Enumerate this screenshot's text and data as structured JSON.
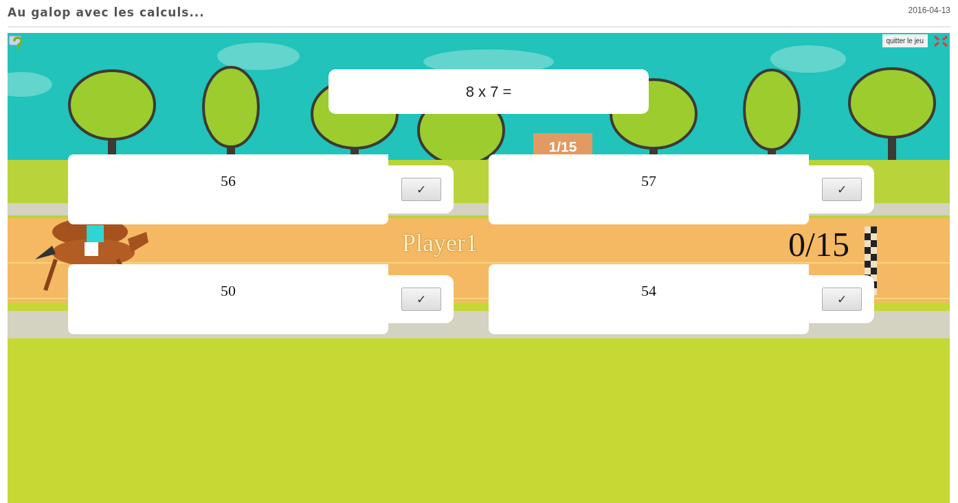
{
  "header": {
    "title": "Au galop avec les calculs...",
    "date": "2016-04-13"
  },
  "game": {
    "quit_button": "quitter le jeu",
    "question": "8 x 7 =",
    "progress": "1/15",
    "lanes": [
      {
        "player": "Player1",
        "score": "0/15"
      }
    ],
    "answers": [
      {
        "value": "56",
        "button": "✓"
      },
      {
        "value": "57",
        "button": "✓"
      },
      {
        "value": "50",
        "button": "✓"
      },
      {
        "value": "54",
        "button": "✓"
      }
    ]
  }
}
